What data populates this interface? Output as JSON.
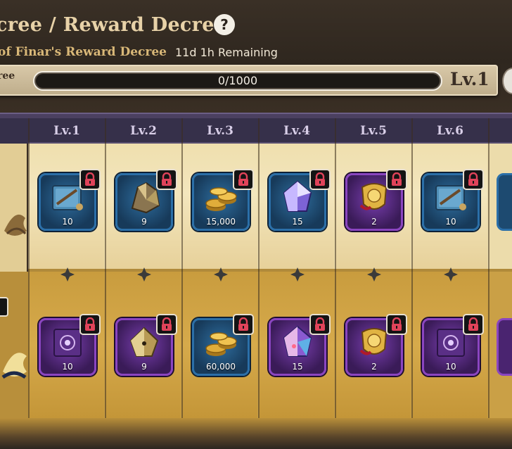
{
  "header": {
    "title": "cree  /  Reward Decree",
    "help_label": "?",
    "decree_name": "of Finar's Reward Decree",
    "remaining": "11d 1h Remaining"
  },
  "progress": {
    "plate_label": "ree",
    "text": "0/1000",
    "current": 0,
    "max": 1000,
    "level": "Lv.1"
  },
  "colors": {
    "free_track": "#ecdcab",
    "premium_track": "#caa046",
    "level_header": "#36304a",
    "blue_frame": "#2b6fa8",
    "purple_frame": "#8a45c0",
    "progress_fill": "#c58b37"
  },
  "levels": [
    {
      "label": "Lv.1",
      "free": {
        "icon": "blue-tome-icon",
        "qty": "10",
        "frame": "blue",
        "locked": true
      },
      "premium": {
        "icon": "purple-tome-icon",
        "qty": "10",
        "frame": "purple",
        "locked": true
      }
    },
    {
      "label": "Lv.2",
      "free": {
        "icon": "ore-crystal-icon",
        "qty": "9",
        "frame": "blue",
        "locked": true
      },
      "premium": {
        "icon": "gold-crystal-icon",
        "qty": "9",
        "frame": "purple",
        "locked": true
      }
    },
    {
      "label": "Lv.3",
      "free": {
        "icon": "gold-coins-icon",
        "qty": "15,000",
        "frame": "blue",
        "locked": true
      },
      "premium": {
        "icon": "gold-coins-icon",
        "qty": "60,000",
        "frame": "blue",
        "locked": true
      }
    },
    {
      "label": "Lv.4",
      "free": {
        "icon": "violet-crystal-icon",
        "qty": "15",
        "frame": "blue",
        "locked": true
      },
      "premium": {
        "icon": "rainbow-crystal-icon",
        "qty": "15",
        "frame": "purple",
        "locked": true
      }
    },
    {
      "label": "Lv.5",
      "free": {
        "icon": "gold-emblem-icon",
        "qty": "2",
        "frame": "purple",
        "locked": true
      },
      "premium": {
        "icon": "gold-emblem-icon",
        "qty": "2",
        "frame": "purple",
        "locked": true
      }
    },
    {
      "label": "Lv.6",
      "free": {
        "icon": "blue-tome-icon",
        "qty": "10",
        "frame": "blue",
        "locked": true
      },
      "premium": {
        "icon": "purple-tome-icon",
        "qty": "10",
        "frame": "purple",
        "locked": true
      }
    }
  ]
}
